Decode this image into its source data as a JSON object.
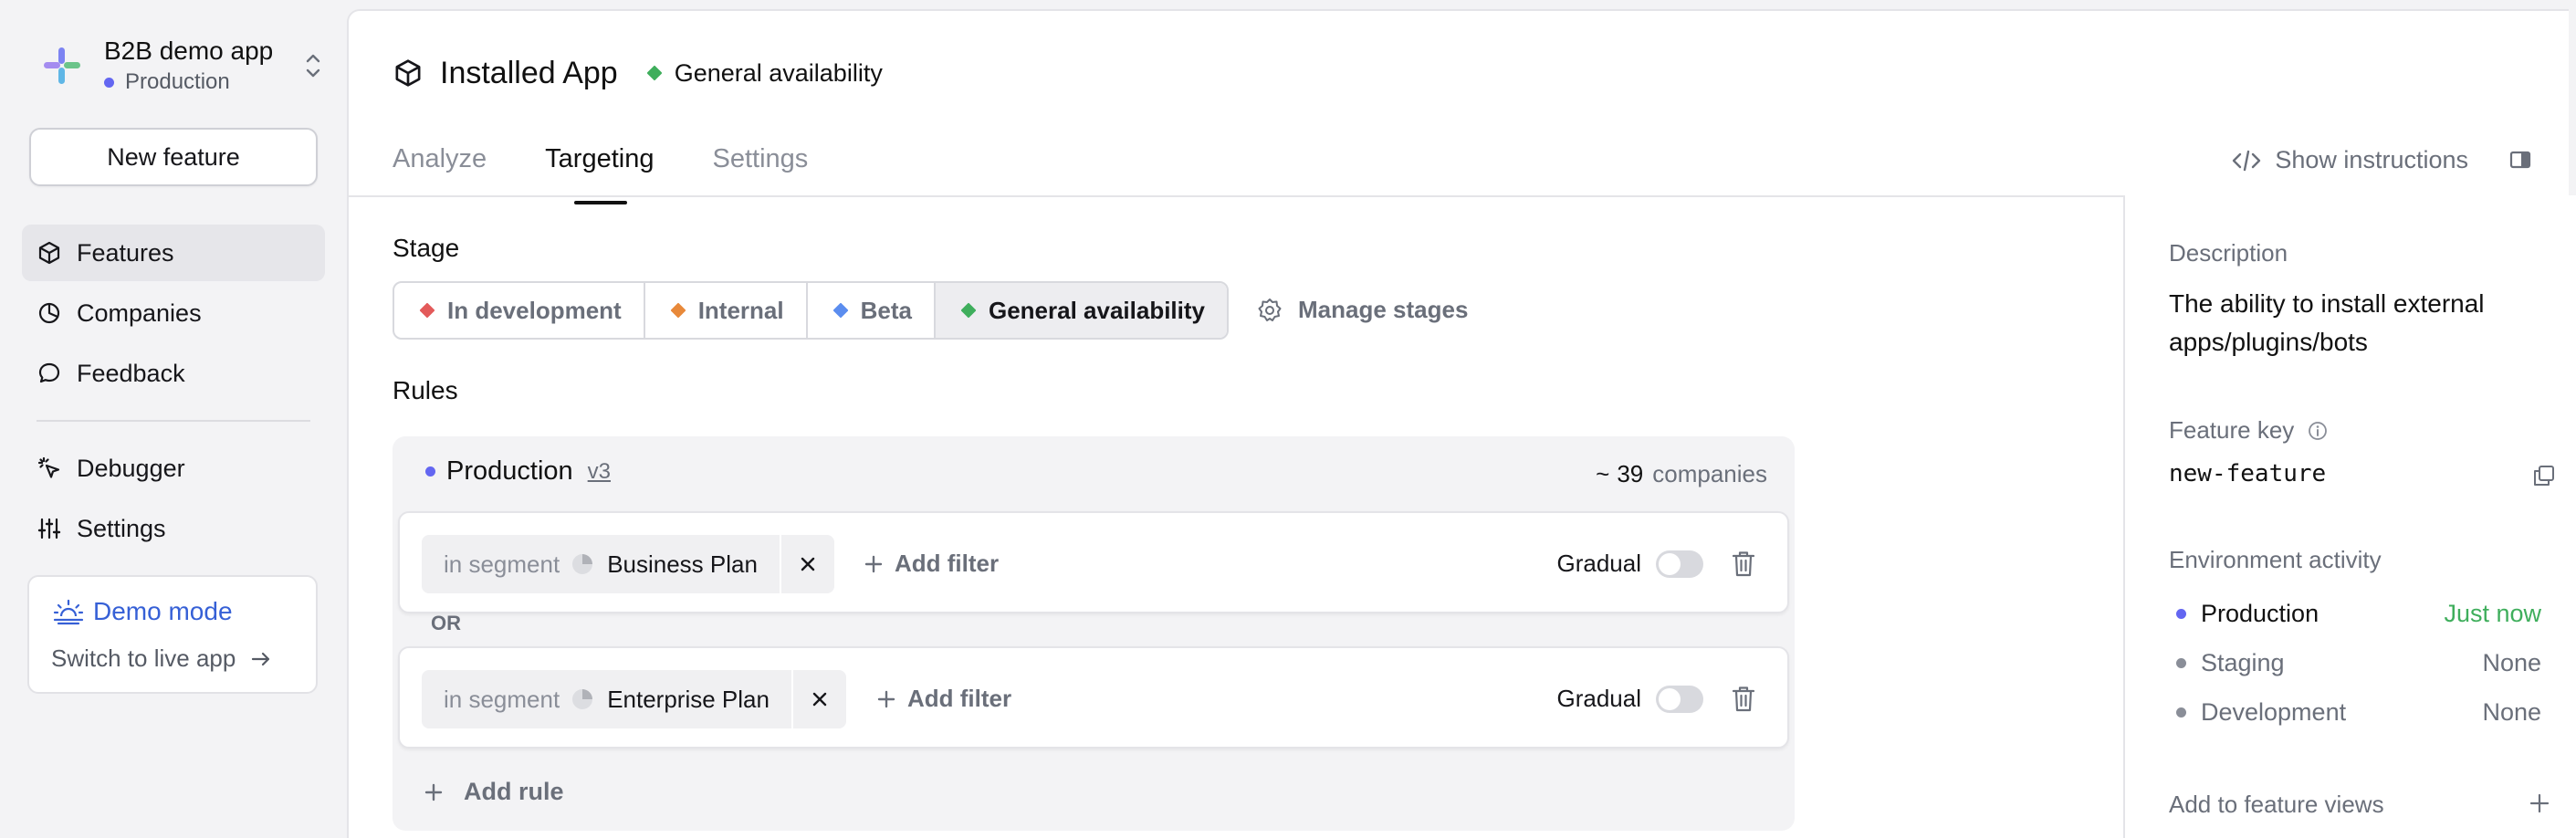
{
  "app": {
    "name": "B2B demo app",
    "environment": "Production",
    "env_color": "#6366f1"
  },
  "sidebar": {
    "new_feature_label": "New feature",
    "items": [
      {
        "label": "Features",
        "icon": "cube-icon",
        "active": true
      },
      {
        "label": "Companies",
        "icon": "pie-chart-icon"
      },
      {
        "label": "Feedback",
        "icon": "chat-bubble-icon"
      },
      {
        "label": "Debugger",
        "icon": "cursor-click-icon"
      },
      {
        "label": "Settings",
        "icon": "sliders-icon"
      }
    ],
    "demo": {
      "title": "Demo mode",
      "subtitle": "Switch to live app"
    }
  },
  "header": {
    "title": "Installed App",
    "stage": "General availability",
    "stage_color": "#3fae5c"
  },
  "tabs": [
    {
      "label": "Analyze"
    },
    {
      "label": "Targeting",
      "active": true
    },
    {
      "label": "Settings"
    }
  ],
  "show_instructions_label": "Show instructions",
  "stage_section": {
    "label": "Stage",
    "options": [
      {
        "label": "In development",
        "color": "#e35a5a"
      },
      {
        "label": "Internal",
        "color": "#e8893a"
      },
      {
        "label": "Beta",
        "color": "#5b8def"
      },
      {
        "label": "General availability",
        "color": "#3fae5c",
        "selected": true
      }
    ],
    "manage_label": "Manage stages"
  },
  "rules_section": {
    "label": "Rules",
    "environment": "Production",
    "version": "v3",
    "approx": "~",
    "company_count": "39",
    "companies_label": "companies",
    "rules": [
      {
        "segment_label": "in segment",
        "segment": "Business Plan",
        "add_filter": "Add filter",
        "gradual": "Gradual"
      },
      {
        "segment_label": "in segment",
        "segment": "Enterprise Plan",
        "add_filter": "Add filter",
        "gradual": "Gradual"
      }
    ],
    "or_label": "OR",
    "add_rule": "Add rule"
  },
  "details": {
    "description_label": "Description",
    "description": "The ability to install external apps/plugins/bots",
    "feature_key_label": "Feature key",
    "feature_key": "new-feature",
    "env_activity_label": "Environment activity",
    "environments": [
      {
        "name": "Production",
        "status": "Just now",
        "dot": "#6366f1",
        "status_color": "#3fae5c"
      },
      {
        "name": "Staging",
        "status": "None",
        "dot": "#8a8e98",
        "status_color": "#6a6f7a"
      },
      {
        "name": "Development",
        "status": "None",
        "dot": "#8a8e98",
        "status_color": "#6a6f7a"
      }
    ],
    "add_views_label": "Add to feature views"
  }
}
